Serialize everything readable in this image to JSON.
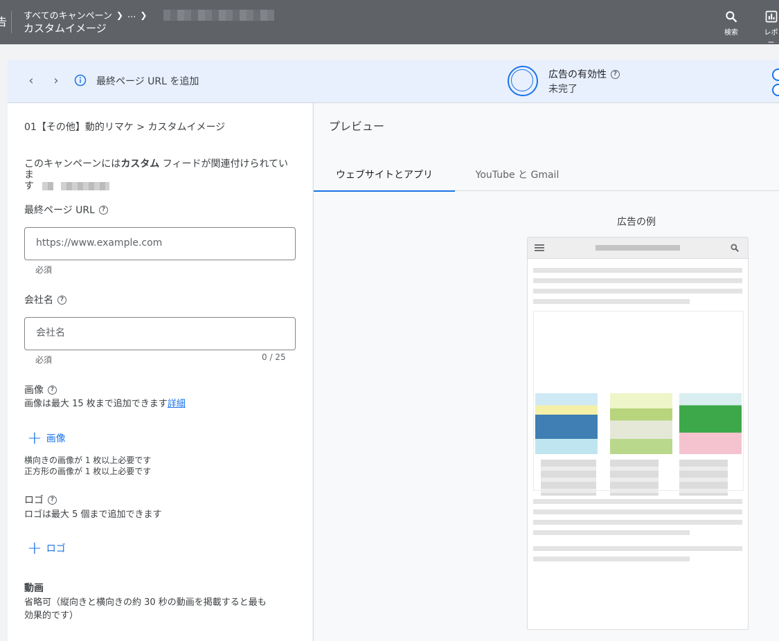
{
  "topbar": {
    "breadcrumb_root": "すべてのキャンペーン",
    "breadcrumb_ellipsis": "...",
    "page_title": "カスタムイメージ",
    "search_label": "検索",
    "report_label": "レポー"
  },
  "header": {
    "message": "最終ページ URL を追加",
    "effectiveness_title": "広告の有効性",
    "effectiveness_status": "未完了"
  },
  "form": {
    "ad_group_path": "01【その他】動的リマケ > カスタムイメージ",
    "feed_notice_pre": "このキャンペーンには",
    "feed_notice_bold": "カスタム",
    "feed_notice_post": " フィードが関連付けられていま",
    "feed_notice_line2": "す",
    "final_url_label": "最終ページ URL",
    "final_url_placeholder": "https://www.example.com",
    "final_url_hint": "必須",
    "company_label": "会社名",
    "company_placeholder": "会社名",
    "company_hint": "必須",
    "company_counter": "0 / 25",
    "images_label": "画像",
    "images_desc": "画像は最大 15 枚まで追加できます",
    "images_link": "詳細",
    "add_image_label": "画像",
    "images_req_1": "横向きの画像が 1 枚以上必要です",
    "images_req_2": "正方形の画像が 1 枚以上必要です",
    "logo_label": "ロゴ",
    "logo_desc": "ロゴは最大 5 個まで追加できます",
    "add_logo_label": "ロゴ",
    "video_label": "動画",
    "video_desc_1": "省略可（縦向きと横向きの約 30 秒の動画を掲載すると最も",
    "video_desc_2": "効果的です）"
  },
  "preview": {
    "title": "プレビュー",
    "tabs": [
      "ウェブサイトとアプリ",
      "YouTube と Gmail"
    ],
    "example_label": "広告の例"
  },
  "colors": {
    "topbar": "#5f6368",
    "accent": "#1a73e8",
    "header_bg": "#e8f0fe"
  }
}
